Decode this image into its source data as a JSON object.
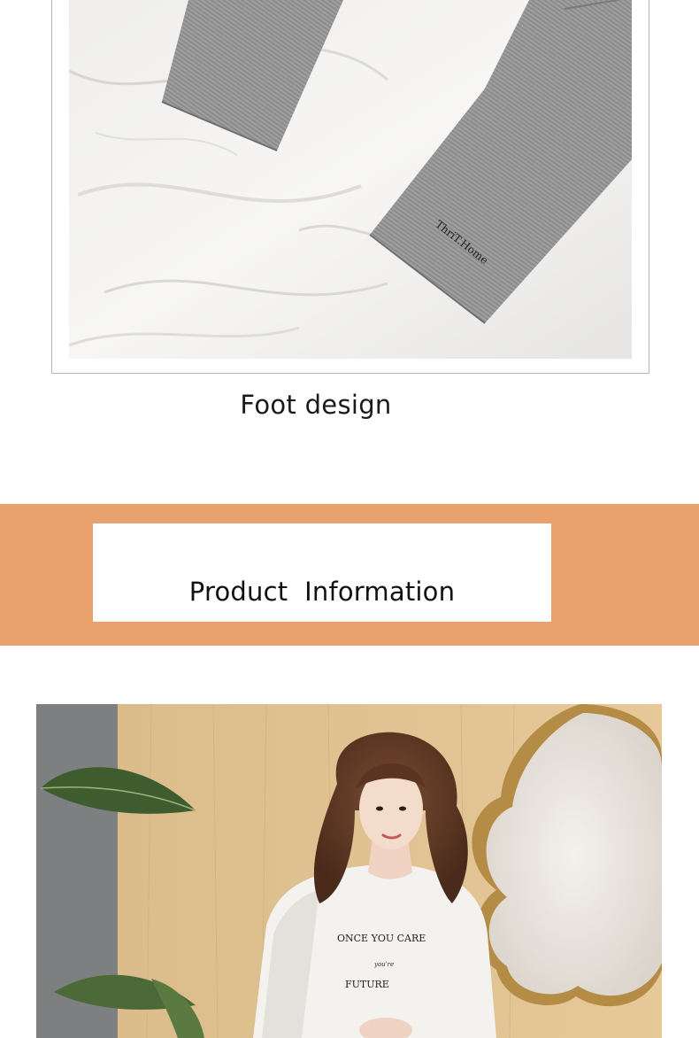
{
  "fabric_photo": {
    "embroidery_text": "ThriT.Home"
  },
  "caption": {
    "text": "Foot design"
  },
  "banner": {
    "title": "Product  Information",
    "color": "#e8a06c"
  },
  "model_photo": {
    "shirt_line1": "ONCE YOU CARE",
    "shirt_line2": "you're",
    "shirt_line3": "FUTURE"
  }
}
